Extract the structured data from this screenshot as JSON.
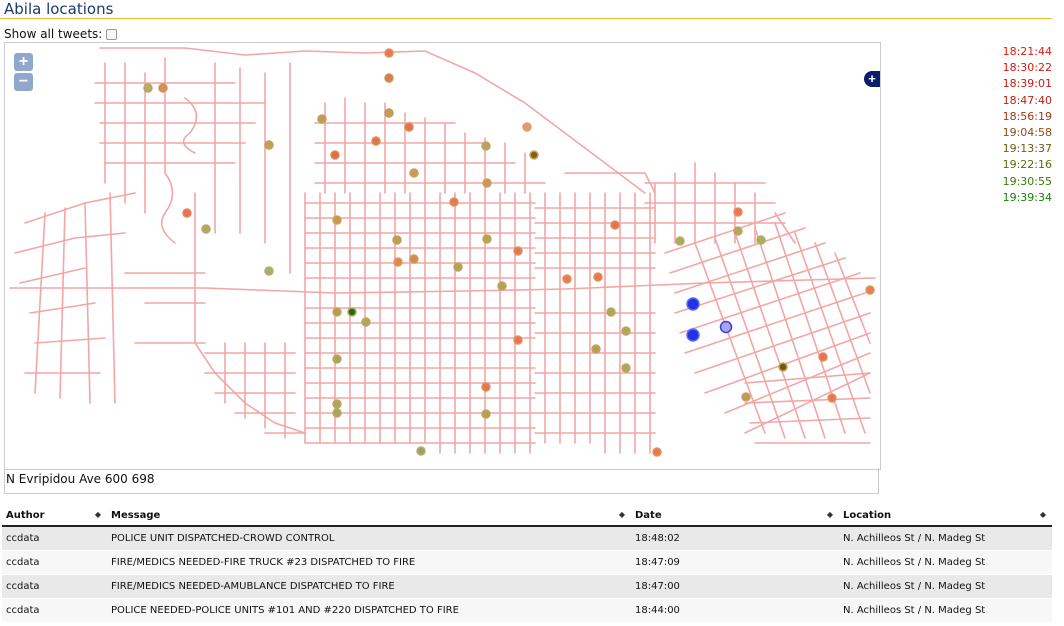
{
  "header": {
    "title": "Abila locations",
    "show_all_label": "Show all tweets:"
  },
  "map": {
    "zoom_in": "+",
    "zoom_out": "−",
    "layer_switcher": "+",
    "address_readout": "N Evripidou Ave 600 698"
  },
  "legend": {
    "times": [
      "18:21:44",
      "18:30:22",
      "18:39:01",
      "18:47:40",
      "18:56:19",
      "19:04:58",
      "19:13:37",
      "19:22:16",
      "19:30:55",
      "19:39:34"
    ],
    "colors": [
      "#e51a0c",
      "#d61a0f",
      "#c51b10",
      "#b82412",
      "#a33611",
      "#8e4e0c",
      "#735e0a",
      "#557008",
      "#39790a",
      "#197d0c"
    ]
  },
  "table": {
    "columns": [
      "Author",
      "Message",
      "Date",
      "Location"
    ],
    "rows": [
      [
        "ccdata",
        "POLICE UNIT DISPATCHED-CROWD CONTROL",
        "18:48:02",
        "N. Achilleos St / N. Madeg St"
      ],
      [
        "ccdata",
        "FIRE/MEDICS NEEDED-FIRE TRUCK #23 DISPATCHED TO FIRE",
        "18:47:09",
        "N. Achilleos St / N. Madeg St"
      ],
      [
        "ccdata",
        "FIRE/MEDICS NEEDED-AMUBLANCE DISPATCHED TO FIRE",
        "18:47:00",
        "N. Achilleos St / N. Madeg St"
      ],
      [
        "ccdata",
        "POLICE NEEDED-POLICE UNITS #101 AND #220 DISPATCHED TO FIRE",
        "18:44:00",
        "N. Achilleos St / N. Madeg St"
      ]
    ]
  }
}
